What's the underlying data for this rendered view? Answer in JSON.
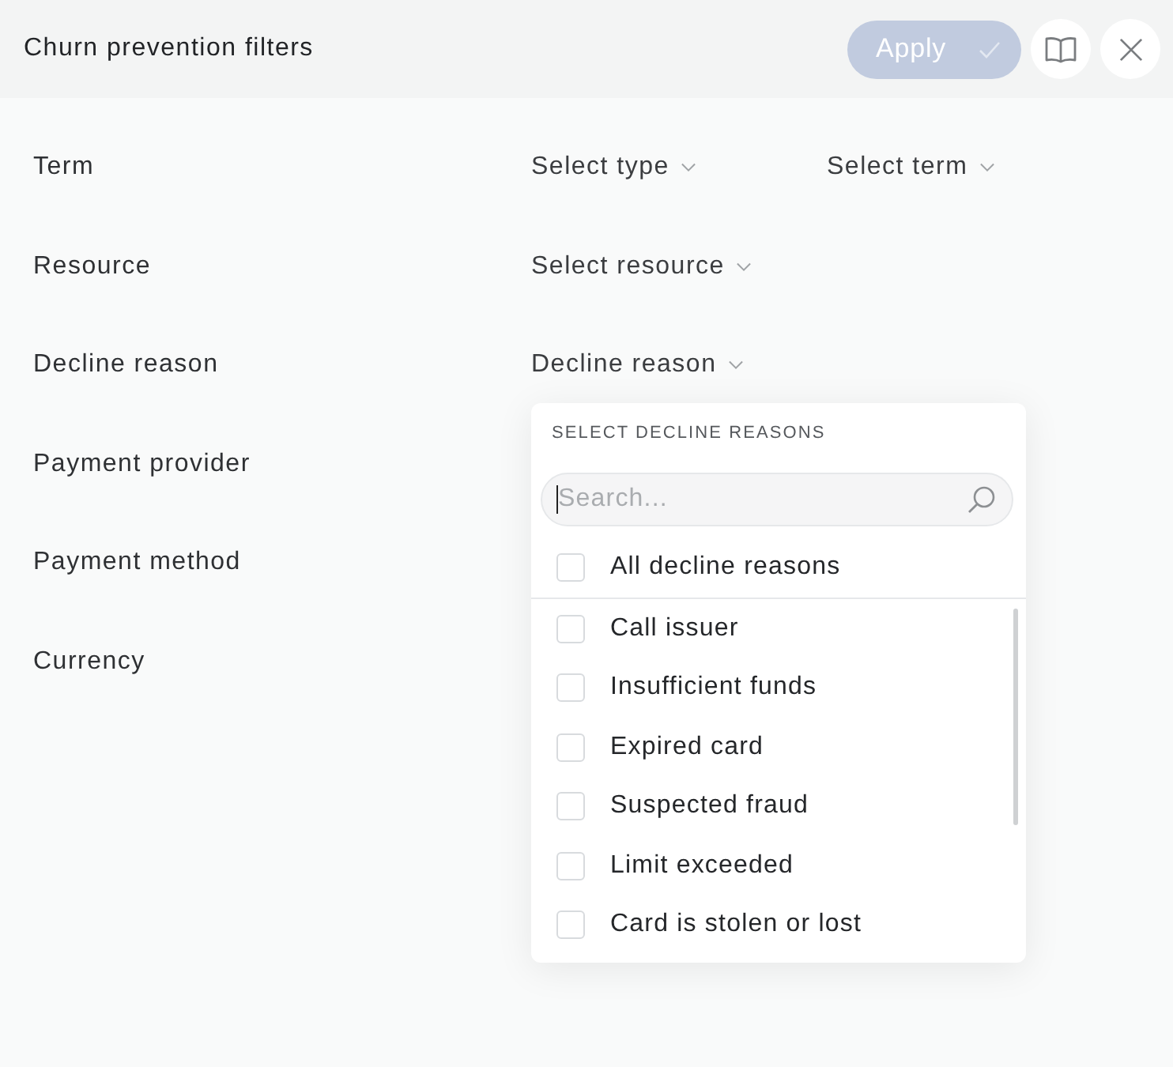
{
  "header": {
    "title": "Churn prevention filters",
    "apply_button": {
      "label": "Apply",
      "disabled": true
    }
  },
  "filters": [
    {
      "label": "Term",
      "selects": [
        {
          "label": "Select type"
        },
        {
          "label": "Select term"
        }
      ]
    },
    {
      "label": "Resource",
      "selects": [
        {
          "label": "Select resource"
        }
      ]
    },
    {
      "label": "Decline reason",
      "selects": [
        {
          "label": "Decline reason",
          "dropdown": {
            "heading": "SELECT DECLINE REASONS",
            "search": {
              "placeholder": "Search...",
              "focused": true
            },
            "all_option": {
              "label": "All decline reasons",
              "checked": false
            },
            "options": [
              {
                "label": "Call issuer",
                "checked": false
              },
              {
                "label": "Insufficient funds",
                "checked": false
              },
              {
                "label": "Expired card",
                "checked": false
              },
              {
                "label": "Suspected fraud",
                "checked": false
              },
              {
                "label": "Limit exceeded",
                "checked": false
              },
              {
                "label": "Card is stolen or lost",
                "checked": false
              }
            ]
          }
        }
      ]
    },
    {
      "label": "Payment provider"
    },
    {
      "label": "Payment method"
    },
    {
      "label": "Currency"
    }
  ]
}
